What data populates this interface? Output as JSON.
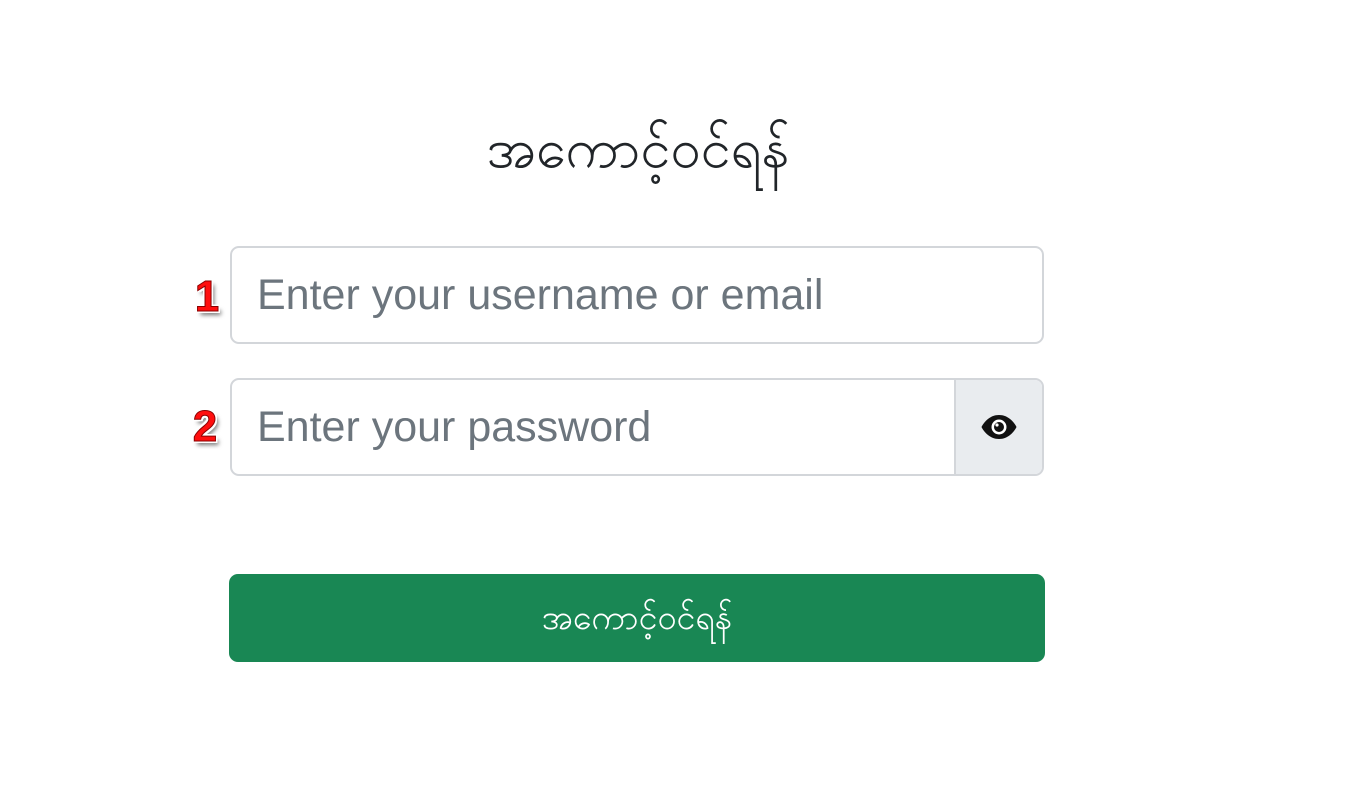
{
  "header": {
    "title": "အကောင့်ဝင်ရန်"
  },
  "form": {
    "username": {
      "marker": "1",
      "placeholder": "Enter your username or email",
      "value": ""
    },
    "password": {
      "marker": "2",
      "placeholder": "Enter your password",
      "value": "",
      "toggle_icon": "eye-icon"
    },
    "submit_label": "အကောင့်ဝင်ရန်"
  },
  "colors": {
    "primary_button": "#198754",
    "marker": "#ff0f0f",
    "input_border": "#d3d6da",
    "toggle_background": "#e9ecef",
    "title_text": "#212529",
    "placeholder_text": "#6c757d"
  }
}
